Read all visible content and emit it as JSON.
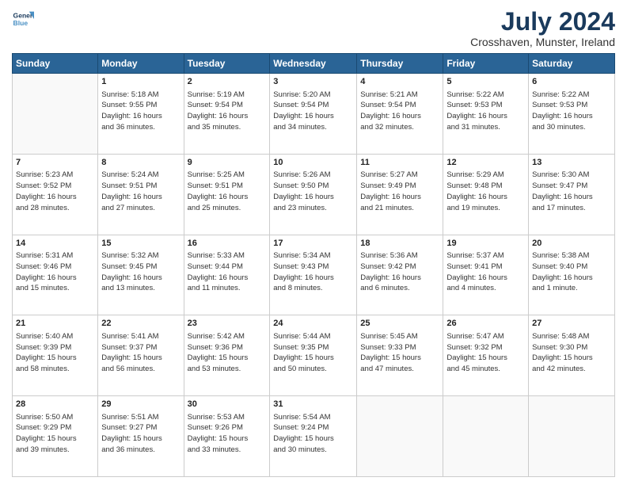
{
  "logo": {
    "line1": "General",
    "line2": "Blue",
    "icon_color": "#4a90c4"
  },
  "title": "July 2024",
  "subtitle": "Crosshaven, Munster, Ireland",
  "days_of_week": [
    "Sunday",
    "Monday",
    "Tuesday",
    "Wednesday",
    "Thursday",
    "Friday",
    "Saturday"
  ],
  "weeks": [
    [
      {
        "day": "",
        "info": ""
      },
      {
        "day": "1",
        "info": "Sunrise: 5:18 AM\nSunset: 9:55 PM\nDaylight: 16 hours\nand 36 minutes."
      },
      {
        "day": "2",
        "info": "Sunrise: 5:19 AM\nSunset: 9:54 PM\nDaylight: 16 hours\nand 35 minutes."
      },
      {
        "day": "3",
        "info": "Sunrise: 5:20 AM\nSunset: 9:54 PM\nDaylight: 16 hours\nand 34 minutes."
      },
      {
        "day": "4",
        "info": "Sunrise: 5:21 AM\nSunset: 9:54 PM\nDaylight: 16 hours\nand 32 minutes."
      },
      {
        "day": "5",
        "info": "Sunrise: 5:22 AM\nSunset: 9:53 PM\nDaylight: 16 hours\nand 31 minutes."
      },
      {
        "day": "6",
        "info": "Sunrise: 5:22 AM\nSunset: 9:53 PM\nDaylight: 16 hours\nand 30 minutes."
      }
    ],
    [
      {
        "day": "7",
        "info": "Sunrise: 5:23 AM\nSunset: 9:52 PM\nDaylight: 16 hours\nand 28 minutes."
      },
      {
        "day": "8",
        "info": "Sunrise: 5:24 AM\nSunset: 9:51 PM\nDaylight: 16 hours\nand 27 minutes."
      },
      {
        "day": "9",
        "info": "Sunrise: 5:25 AM\nSunset: 9:51 PM\nDaylight: 16 hours\nand 25 minutes."
      },
      {
        "day": "10",
        "info": "Sunrise: 5:26 AM\nSunset: 9:50 PM\nDaylight: 16 hours\nand 23 minutes."
      },
      {
        "day": "11",
        "info": "Sunrise: 5:27 AM\nSunset: 9:49 PM\nDaylight: 16 hours\nand 21 minutes."
      },
      {
        "day": "12",
        "info": "Sunrise: 5:29 AM\nSunset: 9:48 PM\nDaylight: 16 hours\nand 19 minutes."
      },
      {
        "day": "13",
        "info": "Sunrise: 5:30 AM\nSunset: 9:47 PM\nDaylight: 16 hours\nand 17 minutes."
      }
    ],
    [
      {
        "day": "14",
        "info": "Sunrise: 5:31 AM\nSunset: 9:46 PM\nDaylight: 16 hours\nand 15 minutes."
      },
      {
        "day": "15",
        "info": "Sunrise: 5:32 AM\nSunset: 9:45 PM\nDaylight: 16 hours\nand 13 minutes."
      },
      {
        "day": "16",
        "info": "Sunrise: 5:33 AM\nSunset: 9:44 PM\nDaylight: 16 hours\nand 11 minutes."
      },
      {
        "day": "17",
        "info": "Sunrise: 5:34 AM\nSunset: 9:43 PM\nDaylight: 16 hours\nand 8 minutes."
      },
      {
        "day": "18",
        "info": "Sunrise: 5:36 AM\nSunset: 9:42 PM\nDaylight: 16 hours\nand 6 minutes."
      },
      {
        "day": "19",
        "info": "Sunrise: 5:37 AM\nSunset: 9:41 PM\nDaylight: 16 hours\nand 4 minutes."
      },
      {
        "day": "20",
        "info": "Sunrise: 5:38 AM\nSunset: 9:40 PM\nDaylight: 16 hours\nand 1 minute."
      }
    ],
    [
      {
        "day": "21",
        "info": "Sunrise: 5:40 AM\nSunset: 9:39 PM\nDaylight: 15 hours\nand 58 minutes."
      },
      {
        "day": "22",
        "info": "Sunrise: 5:41 AM\nSunset: 9:37 PM\nDaylight: 15 hours\nand 56 minutes."
      },
      {
        "day": "23",
        "info": "Sunrise: 5:42 AM\nSunset: 9:36 PM\nDaylight: 15 hours\nand 53 minutes."
      },
      {
        "day": "24",
        "info": "Sunrise: 5:44 AM\nSunset: 9:35 PM\nDaylight: 15 hours\nand 50 minutes."
      },
      {
        "day": "25",
        "info": "Sunrise: 5:45 AM\nSunset: 9:33 PM\nDaylight: 15 hours\nand 47 minutes."
      },
      {
        "day": "26",
        "info": "Sunrise: 5:47 AM\nSunset: 9:32 PM\nDaylight: 15 hours\nand 45 minutes."
      },
      {
        "day": "27",
        "info": "Sunrise: 5:48 AM\nSunset: 9:30 PM\nDaylight: 15 hours\nand 42 minutes."
      }
    ],
    [
      {
        "day": "28",
        "info": "Sunrise: 5:50 AM\nSunset: 9:29 PM\nDaylight: 15 hours\nand 39 minutes."
      },
      {
        "day": "29",
        "info": "Sunrise: 5:51 AM\nSunset: 9:27 PM\nDaylight: 15 hours\nand 36 minutes."
      },
      {
        "day": "30",
        "info": "Sunrise: 5:53 AM\nSunset: 9:26 PM\nDaylight: 15 hours\nand 33 minutes."
      },
      {
        "day": "31",
        "info": "Sunrise: 5:54 AM\nSunset: 9:24 PM\nDaylight: 15 hours\nand 30 minutes."
      },
      {
        "day": "",
        "info": ""
      },
      {
        "day": "",
        "info": ""
      },
      {
        "day": "",
        "info": ""
      }
    ]
  ]
}
